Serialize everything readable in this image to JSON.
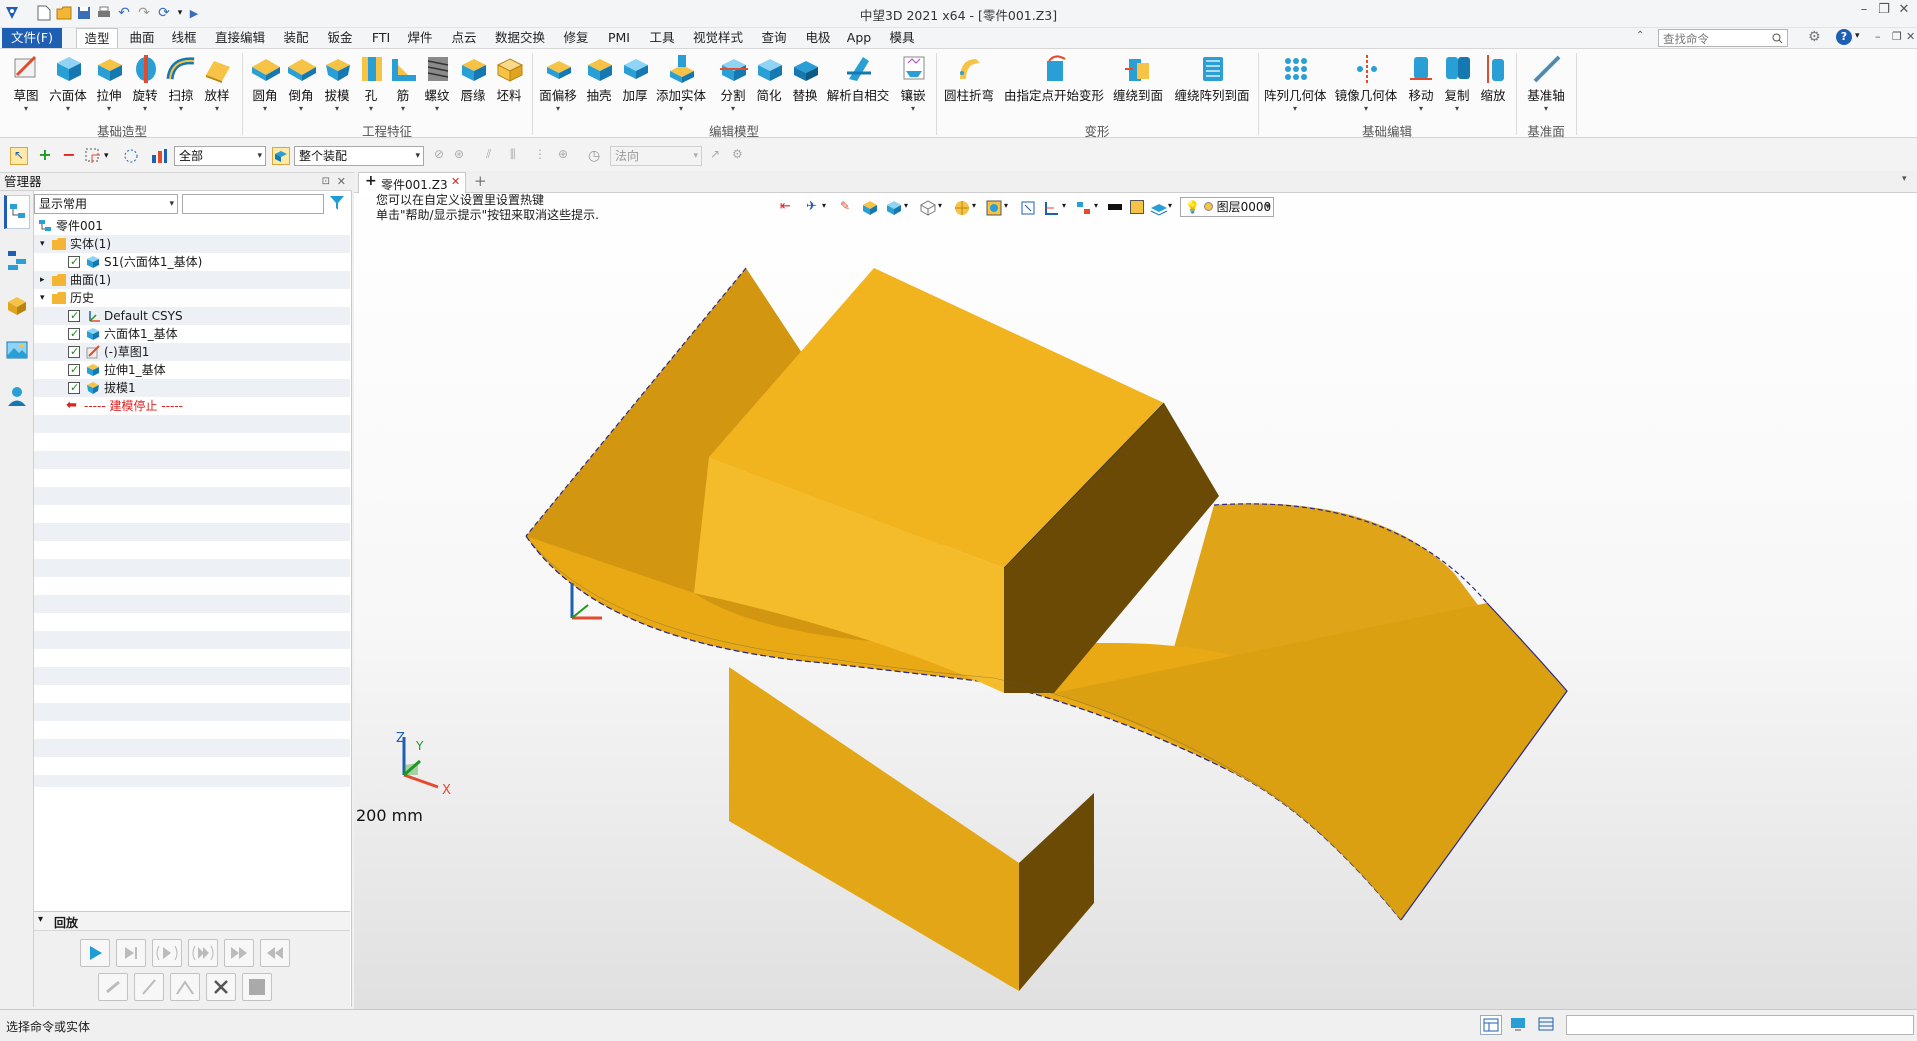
{
  "window": {
    "title": "中望3D 2021 x64 - [零件001.Z3]",
    "controls": {
      "minimize": "–",
      "restore": "❐",
      "close": "✕"
    }
  },
  "menu": {
    "file": "文件(F)",
    "tabs": [
      "造型",
      "曲面",
      "线框",
      "直接编辑",
      "装配",
      "钣金",
      "FTI",
      "焊件",
      "点云",
      "数据交换",
      "修复",
      "PMI",
      "工具",
      "视觉样式",
      "查询",
      "电极",
      "App",
      "模具"
    ],
    "active_tab": "造型",
    "search_placeholder": "查找命令"
  },
  "ribbon": {
    "groups": [
      {
        "label": "基础造型",
        "buttons": [
          "草图",
          "六面体",
          "拉伸",
          "旋转",
          "扫掠",
          "放样"
        ]
      },
      {
        "label": "工程特征",
        "buttons": [
          "圆角",
          "倒角",
          "拔模",
          "孔",
          "筋",
          "螺纹",
          "唇缘",
          "坯料"
        ]
      },
      {
        "label": "编辑模型",
        "buttons": [
          "面偏移",
          "抽壳",
          "加厚",
          "添加实体",
          "分割",
          "简化",
          "替换",
          "解析自相交",
          "镶嵌"
        ]
      },
      {
        "label": "变形",
        "buttons": [
          "圆柱折弯",
          "由指定点开始变形",
          "缠绕到面",
          "缠绕阵列到面"
        ]
      },
      {
        "label": "基础编辑",
        "buttons": [
          "阵列几何体",
          "镜像几何体",
          "移动",
          "复制",
          "缩放"
        ]
      },
      {
        "label": "基准面",
        "buttons": [
          "基准轴"
        ]
      }
    ]
  },
  "toolbar2": {
    "filter_value": "全部",
    "assembly_value": "整个装配",
    "normal_value": "法向"
  },
  "manager": {
    "title": "管理器",
    "display_combo": "显示常用",
    "tree": [
      {
        "text": "零件001",
        "indent": 0
      },
      {
        "text": "实体(1)",
        "indent": 1
      },
      {
        "text": "S1(六面体1_基体)",
        "indent": 2
      },
      {
        "text": "曲面(1)",
        "indent": 1
      },
      {
        "text": "历史",
        "indent": 1
      },
      {
        "text": "Default CSYS",
        "indent": 2
      },
      {
        "text": "六面体1_基体",
        "indent": 2
      },
      {
        "text": "(-)草图1",
        "indent": 2
      },
      {
        "text": "拉伸1_基体",
        "indent": 2
      },
      {
        "text": "拔模1",
        "indent": 2
      },
      {
        "text": "----- 建模停止 -----",
        "indent": 2
      }
    ],
    "playback_title": "回放"
  },
  "document": {
    "tab_label": "零件001.Z3",
    "hint_line1": "您可以在自定义设置里设置热键",
    "hint_line2": "单击\"帮助/显示提示\"按钮来取消这些提示.",
    "layer": "图层0000",
    "scale_label": "200 mm",
    "axes": {
      "x": "X",
      "y": "Y",
      "z": "Z"
    }
  },
  "status": {
    "text": "选择命令或实体"
  },
  "colors": {
    "accent": "#1e5fb3",
    "model_gold": "#e8a914",
    "edge_blue": "#2a2a8a"
  }
}
